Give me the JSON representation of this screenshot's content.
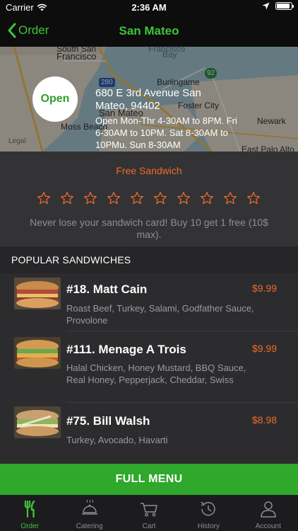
{
  "status_bar": {
    "carrier": "Carrier",
    "time": "2:36 AM"
  },
  "nav": {
    "back_label": "Order",
    "title": "San Mateo"
  },
  "map": {
    "open_label": "Open",
    "address": "680 E 3rd Avenue San Mateo, 94402",
    "hours": "Open Mon-Thr 4-30AM to 8PM. Fri 6-30AM to 10PM. Sat 8-30AM to 10PMu. Sun 8-30AM",
    "legal": "Legal",
    "labels": {
      "south_sf": "South San",
      "francisco": "Francisco",
      "sf_bay": "Francisco",
      "bay": "Bay",
      "burlingame": "Burlingame",
      "route_280": "280",
      "route_92": "92",
      "san_mateo": "San Mateo",
      "foster_city": "Foster City",
      "moss_beach": "Moss Beach",
      "newark": "Newark",
      "east_palo_alto": "East Palo Alto"
    }
  },
  "loyalty": {
    "title": "Free Sandwich",
    "star_count": 10,
    "note": "Never lose your sandwich card! Buy 10 get 1 free (10$ max)."
  },
  "section": {
    "title": "POPULAR SANDWICHES"
  },
  "sandwiches": [
    {
      "name": "#18. Matt Cain",
      "price": "$9.99",
      "description": "Roast Beef, Turkey, Salami, Godfather Sauce, Provolone"
    },
    {
      "name": "#111. Menage A Trois",
      "price": "$9.99",
      "description": "Halal Chicken, Honey Mustard, BBQ Sauce, Real Honey, Pepperjack, Cheddar, Swiss"
    },
    {
      "name": "#75. Bill Walsh",
      "price": "$8.98",
      "description": "Turkey, Avocado, Havarti"
    }
  ],
  "full_menu_label": "FULL MENU",
  "tabs": [
    {
      "label": "Order",
      "icon": "fork-knife-icon",
      "active": true
    },
    {
      "label": "Catering",
      "icon": "cloche-icon",
      "active": false
    },
    {
      "label": "Cart",
      "icon": "cart-icon",
      "active": false
    },
    {
      "label": "History",
      "icon": "history-clock-icon",
      "active": false
    },
    {
      "label": "Account",
      "icon": "person-icon",
      "active": false
    }
  ],
  "colors": {
    "accent_green": "#3ec43a",
    "button_green": "#2fa82c",
    "accent_orange": "#f06a2a"
  }
}
